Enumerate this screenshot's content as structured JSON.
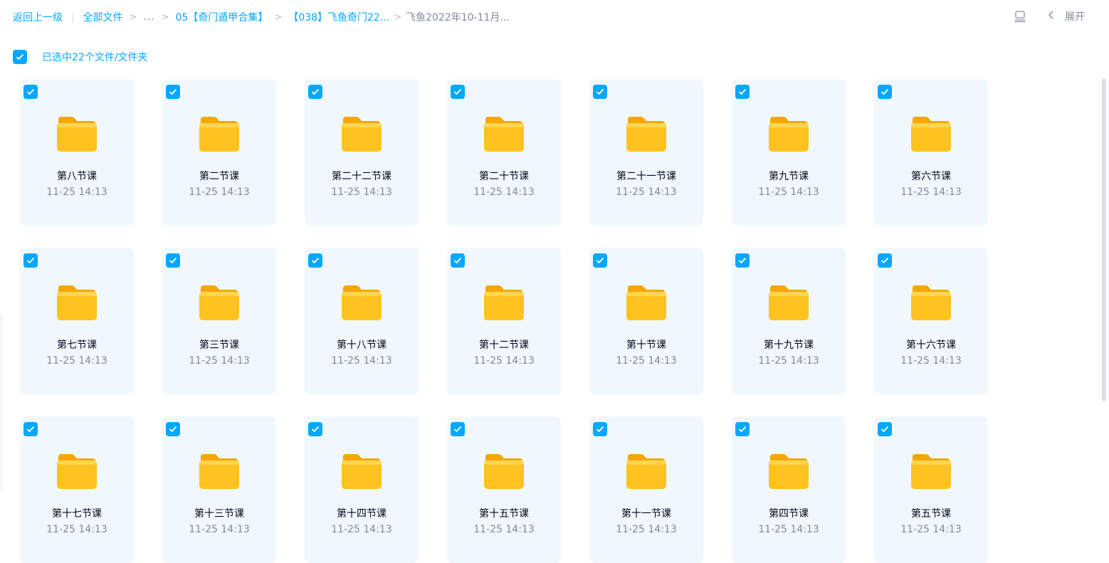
{
  "breadcrumb": {
    "back_label": "返回上一级",
    "all_files_label": "全部文件",
    "ellipsis_label": "...",
    "crumb_1": "05【奇门遁甲合集】",
    "crumb_2": "【038】飞鱼奇门22...",
    "current": "飞鱼2022年10-11月..."
  },
  "toolbar": {
    "expand_label": "展开"
  },
  "selection": {
    "count_label": "已选中22个文件/文件夹",
    "checked": true
  },
  "folders": [
    {
      "name": "第八节课",
      "time": "11-25 14:13",
      "checked": true
    },
    {
      "name": "第二节课",
      "time": "11-25 14:13",
      "checked": true
    },
    {
      "name": "第二十二节课",
      "time": "11-25 14:13",
      "checked": true
    },
    {
      "name": "第二十节课",
      "time": "11-25 14:13",
      "checked": true
    },
    {
      "name": "第二十一节课",
      "time": "11-25 14:13",
      "checked": true
    },
    {
      "name": "第九节课",
      "time": "11-25 14:13",
      "checked": true
    },
    {
      "name": "第六节课",
      "time": "11-25 14:13",
      "checked": true
    },
    {
      "name": "第七节课",
      "time": "11-25 14:13",
      "checked": true
    },
    {
      "name": "第三节课",
      "time": "11-25 14:13",
      "checked": true
    },
    {
      "name": "第十八节课",
      "time": "11-25 14:13",
      "checked": true
    },
    {
      "name": "第十二节课",
      "time": "11-25 14:13",
      "checked": true
    },
    {
      "name": "第十节课",
      "time": "11-25 14:13",
      "checked": true
    },
    {
      "name": "第十九节课",
      "time": "11-25 14:13",
      "checked": true
    },
    {
      "name": "第十六节课",
      "time": "11-25 14:13",
      "checked": true
    },
    {
      "name": "第十七节课",
      "time": "11-25 14:13",
      "checked": true
    },
    {
      "name": "第十三节课",
      "time": "11-25 14:13",
      "checked": true
    },
    {
      "name": "第十四节课",
      "time": "11-25 14:13",
      "checked": true
    },
    {
      "name": "第十五节课",
      "time": "11-25 14:13",
      "checked": true
    },
    {
      "name": "第十一节课",
      "time": "11-25 14:13",
      "checked": true
    },
    {
      "name": "第四节课",
      "time": "11-25 14:13",
      "checked": true
    },
    {
      "name": "第五节课",
      "time": "11-25 14:13",
      "checked": true
    }
  ],
  "colors": {
    "accent": "#06a7ff",
    "card_bg": "#f0f8fe",
    "folder_yellow": "#ffc21f",
    "text_primary": "#03081a",
    "text_secondary": "#818999"
  },
  "icons": {
    "folder": "folder-icon",
    "checkbox": "checkbox-checked-icon",
    "list_view": "list-view-icon",
    "collapse": "chevron-left-icon"
  }
}
